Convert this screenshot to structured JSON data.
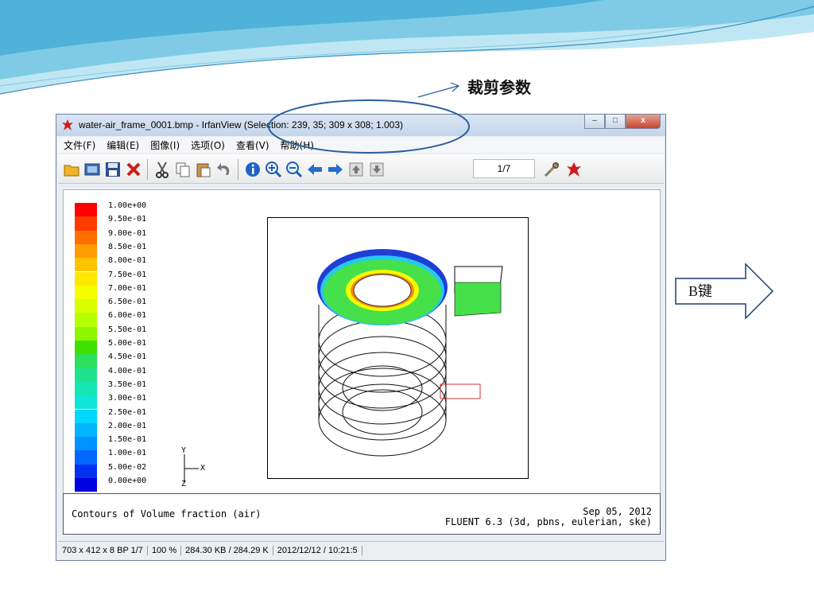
{
  "annotation": {
    "text": "裁剪参数",
    "key_label": "B键"
  },
  "window": {
    "title": "water-air_frame_0001.bmp - IrfanView (Selection: 239, 35; 309 x 308; 1.003)",
    "buttons": {
      "minimize": "–",
      "maximize": "□",
      "close": "x"
    }
  },
  "menu": [
    "文件(F)",
    "编辑(E)",
    "图像(I)",
    "选项(O)",
    "查看(V)",
    "帮助(H)"
  ],
  "toolbar": {
    "page_indicator": "1/7",
    "icons": [
      "open-folder-icon",
      "slideshow-icon",
      "save-icon",
      "delete-icon",
      "cut-icon",
      "copy-icon",
      "paste-icon",
      "undo-icon",
      "info-icon",
      "zoom-in-icon",
      "zoom-out-icon",
      "prev-arrow-icon",
      "next-arrow-icon",
      "first-page-icon",
      "last-page-icon",
      "settings-icon",
      "irfanview-logo-icon"
    ]
  },
  "legend": {
    "labels": [
      "1.00e+00",
      "9.50e-01",
      "9.00e-01",
      "8.50e-01",
      "8.00e-01",
      "7.50e-01",
      "7.00e-01",
      "6.50e-01",
      "6.00e-01",
      "5.50e-01",
      "5.00e-01",
      "4.50e-01",
      "4.00e-01",
      "3.50e-01",
      "3.00e-01",
      "2.50e-01",
      "2.00e-01",
      "1.50e-01",
      "1.00e-01",
      "5.00e-02",
      "0.00e+00"
    ],
    "colors": [
      "#ff0000",
      "#ff3a00",
      "#ff6f00",
      "#ff9c00",
      "#ffc400",
      "#ffe600",
      "#f6ff00",
      "#d8ff00",
      "#b4ff00",
      "#8cf500",
      "#40e000",
      "#2ddf5a",
      "#20e38f",
      "#16e6b6",
      "#0de6d8",
      "#00d7ff",
      "#00b4ff",
      "#0092ff",
      "#0066ff",
      "#0032f0",
      "#0000e0"
    ]
  },
  "axes": {
    "y": "Y",
    "x": "X",
    "z": "Z"
  },
  "caption": {
    "left": "Contours of Volume fraction (air)",
    "right_line1": "Sep 05, 2012",
    "right_line2": "FLUENT 6.3 (3d, pbns, eulerian, ske)"
  },
  "status": [
    "703 x 412 x 8 BP 1/7",
    "100 %",
    "284.30 KB / 284.29 K",
    "2012/12/12 / 10:21:5"
  ]
}
